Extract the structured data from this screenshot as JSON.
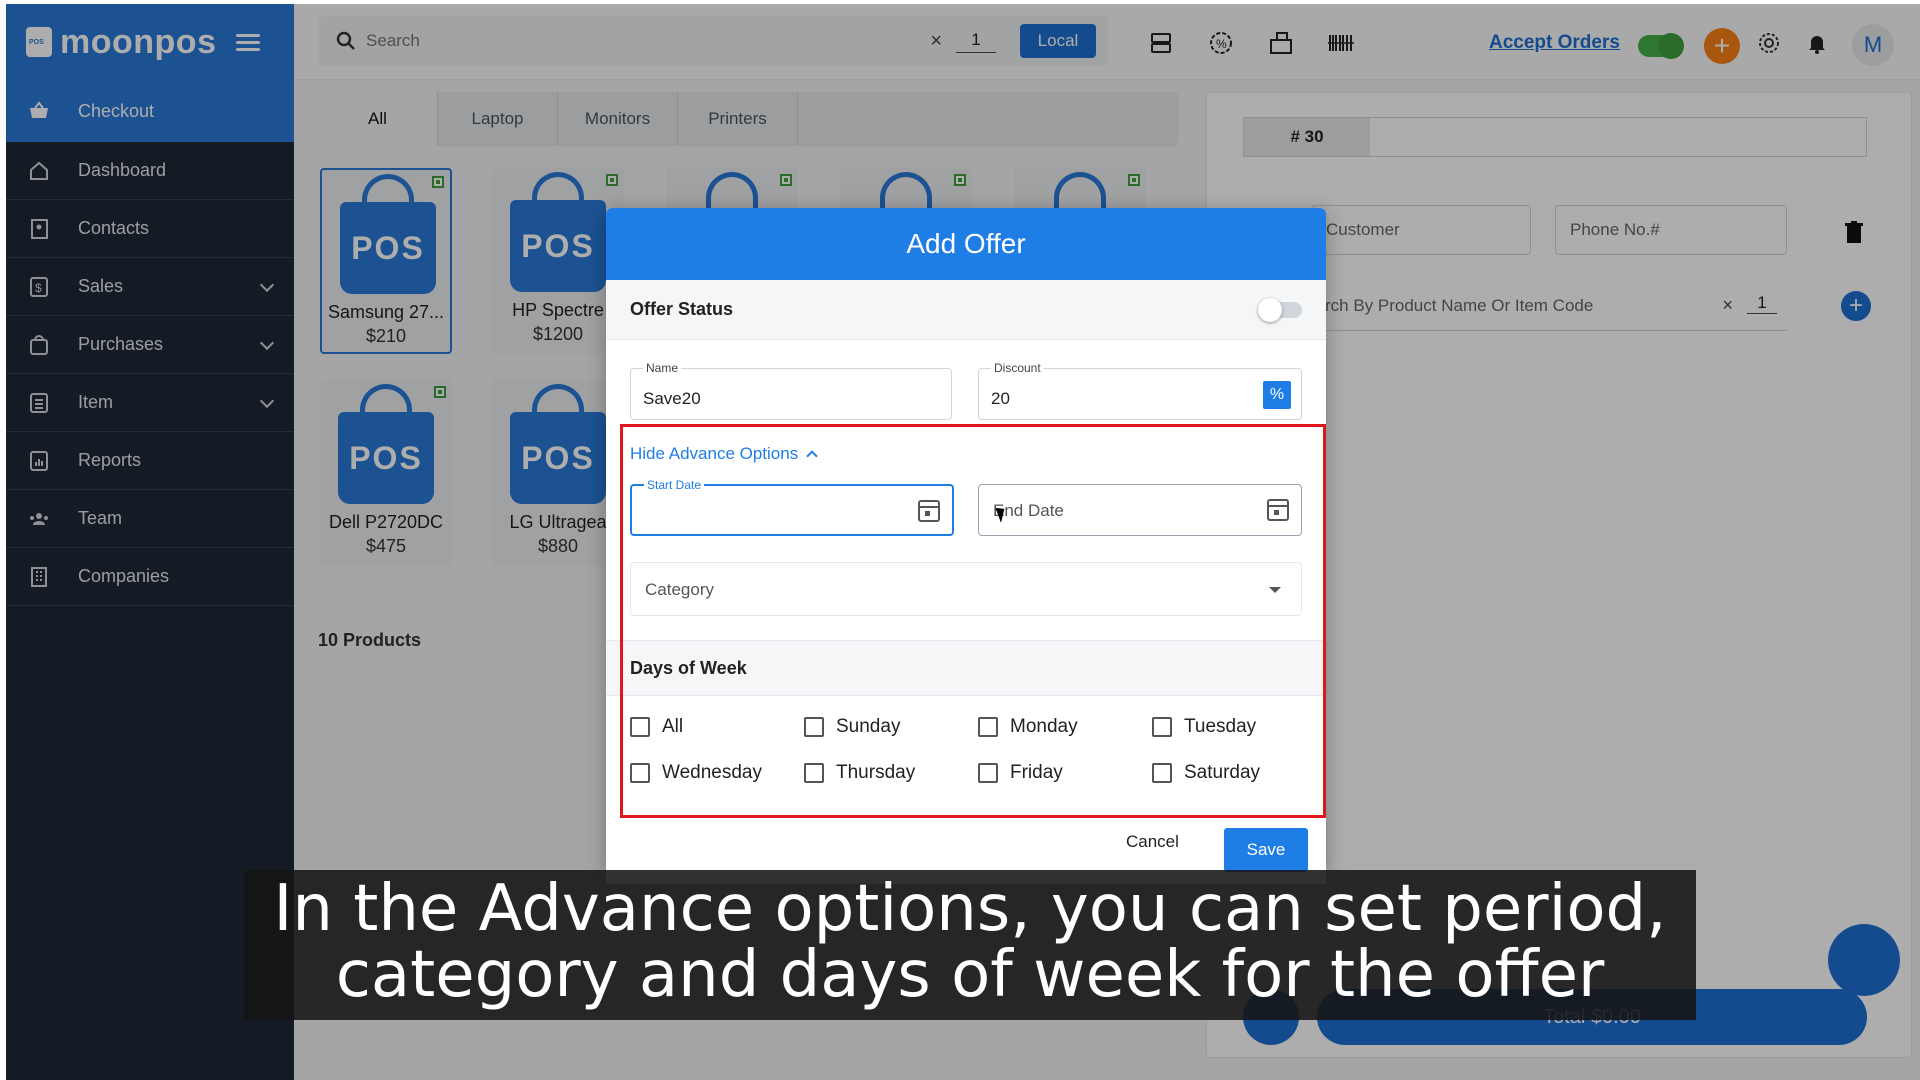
{
  "brand": {
    "name": "moonpos"
  },
  "sidebar": {
    "items": [
      {
        "label": "Checkout",
        "icon": "basket-icon",
        "active": true
      },
      {
        "label": "Dashboard",
        "icon": "home-icon"
      },
      {
        "label": "Contacts",
        "icon": "contacts-icon"
      },
      {
        "label": "Sales",
        "icon": "dollar-icon",
        "expandable": true
      },
      {
        "label": "Purchases",
        "icon": "bag-icon",
        "expandable": true
      },
      {
        "label": "Item",
        "icon": "list-icon",
        "expandable": true
      },
      {
        "label": "Reports",
        "icon": "chart-icon"
      },
      {
        "label": "Team",
        "icon": "team-icon"
      },
      {
        "label": "Companies",
        "icon": "building-icon"
      }
    ]
  },
  "topbar": {
    "search_placeholder": "Search",
    "search_clear": "×",
    "quantity": "1",
    "local_label": "Local",
    "accept_orders": "Accept Orders",
    "avatar_initial": "M",
    "add_symbol": "+"
  },
  "categories": [
    "All",
    "Laptop",
    "Monitors",
    "Printers"
  ],
  "products": [
    {
      "logo": "POS",
      "name": "Samsung 27...",
      "price": "$210"
    },
    {
      "logo": "POS",
      "name": "HP Spectre",
      "price": "$1200"
    },
    {
      "logo": "POS",
      "name": "Dell P2720DC",
      "price": "$475"
    },
    {
      "logo": "POS",
      "name": "LG Ultragea",
      "price": "$880"
    }
  ],
  "products_count": "10 Products",
  "order": {
    "tab_label": "# 30",
    "customer_placeholder": "Customer",
    "phone_placeholder": "Phone No.#",
    "product_search_placeholder": "rch By Product Name Or Item Code",
    "clear": "×",
    "quantity": "1",
    "add_symbol": "+",
    "total_label": "Total $0.00"
  },
  "modal": {
    "title": "Add Offer",
    "offer_status_label": "Offer Status",
    "name_label": "Name",
    "name_value": "Save20",
    "discount_label": "Discount",
    "discount_value": "20",
    "percent_symbol": "%",
    "hide_advance_label": "Hide Advance Options",
    "start_date_label": "Start Date",
    "end_date_placeholder": "End Date",
    "category_placeholder": "Category",
    "days_of_week_label": "Days of Week",
    "days": [
      "All",
      "Sunday",
      "Monday",
      "Tuesday",
      "Wednesday",
      "Thursday",
      "Friday",
      "Saturday"
    ],
    "cancel_label": "Cancel",
    "save_label": "Save"
  },
  "caption": {
    "line1": "In the Advance options, you can set period,",
    "line2": "category and days of week for the offer"
  },
  "colors": {
    "primary": "#1e7ee6",
    "sidebar": "#1f2937",
    "highlight": "#e0161e",
    "accept_toggle": "#3ea13e",
    "orange": "#f97f16"
  }
}
